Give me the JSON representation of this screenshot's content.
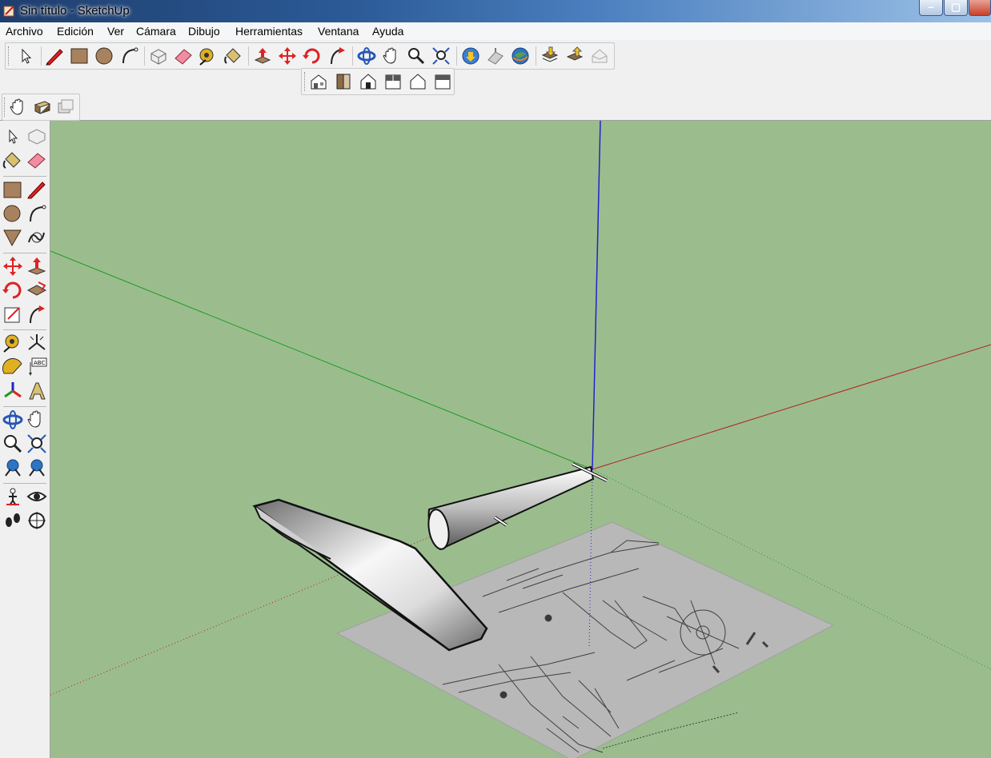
{
  "window": {
    "title": "Sin título - SketchUp"
  },
  "menubar": [
    "Archivo",
    "Edición",
    "Ver",
    "Cámara",
    "Dibujo",
    "Herramientas",
    "Ventana",
    "Ayuda"
  ],
  "colors": {
    "background": "#9bbd8e",
    "axis_red": "#b2241b",
    "axis_green": "#1f9a1f",
    "axis_blue": "#2222cc"
  },
  "toolbars": {
    "main": [
      "select-icon",
      "pencil-icon",
      "rectangle-icon",
      "circle-icon",
      "arc-icon",
      "make-component-icon",
      "eraser-icon",
      "tape-measure-icon",
      "paint-bucket-icon",
      "push-pull-icon",
      "move-icon",
      "rotate-icon",
      "follow-me-icon",
      "orbit-icon",
      "pan-icon",
      "zoom-icon",
      "zoom-extents-icon",
      "get-models-icon",
      "share-model-icon",
      "google-earth-icon",
      "get-photo-texture-icon",
      "layers-in-icon",
      "layers-out-icon"
    ],
    "views": [
      "iso-view-icon",
      "top-view-icon",
      "front-view-icon",
      "right-view-icon",
      "back-view-icon",
      "left-view-icon"
    ],
    "small": [
      "position-camera-icon",
      "walk-icon",
      "section-plane-icon"
    ]
  },
  "viewport": {
    "objects": [
      "fuselage-model",
      "wing-model",
      "blueprint-image"
    ]
  }
}
